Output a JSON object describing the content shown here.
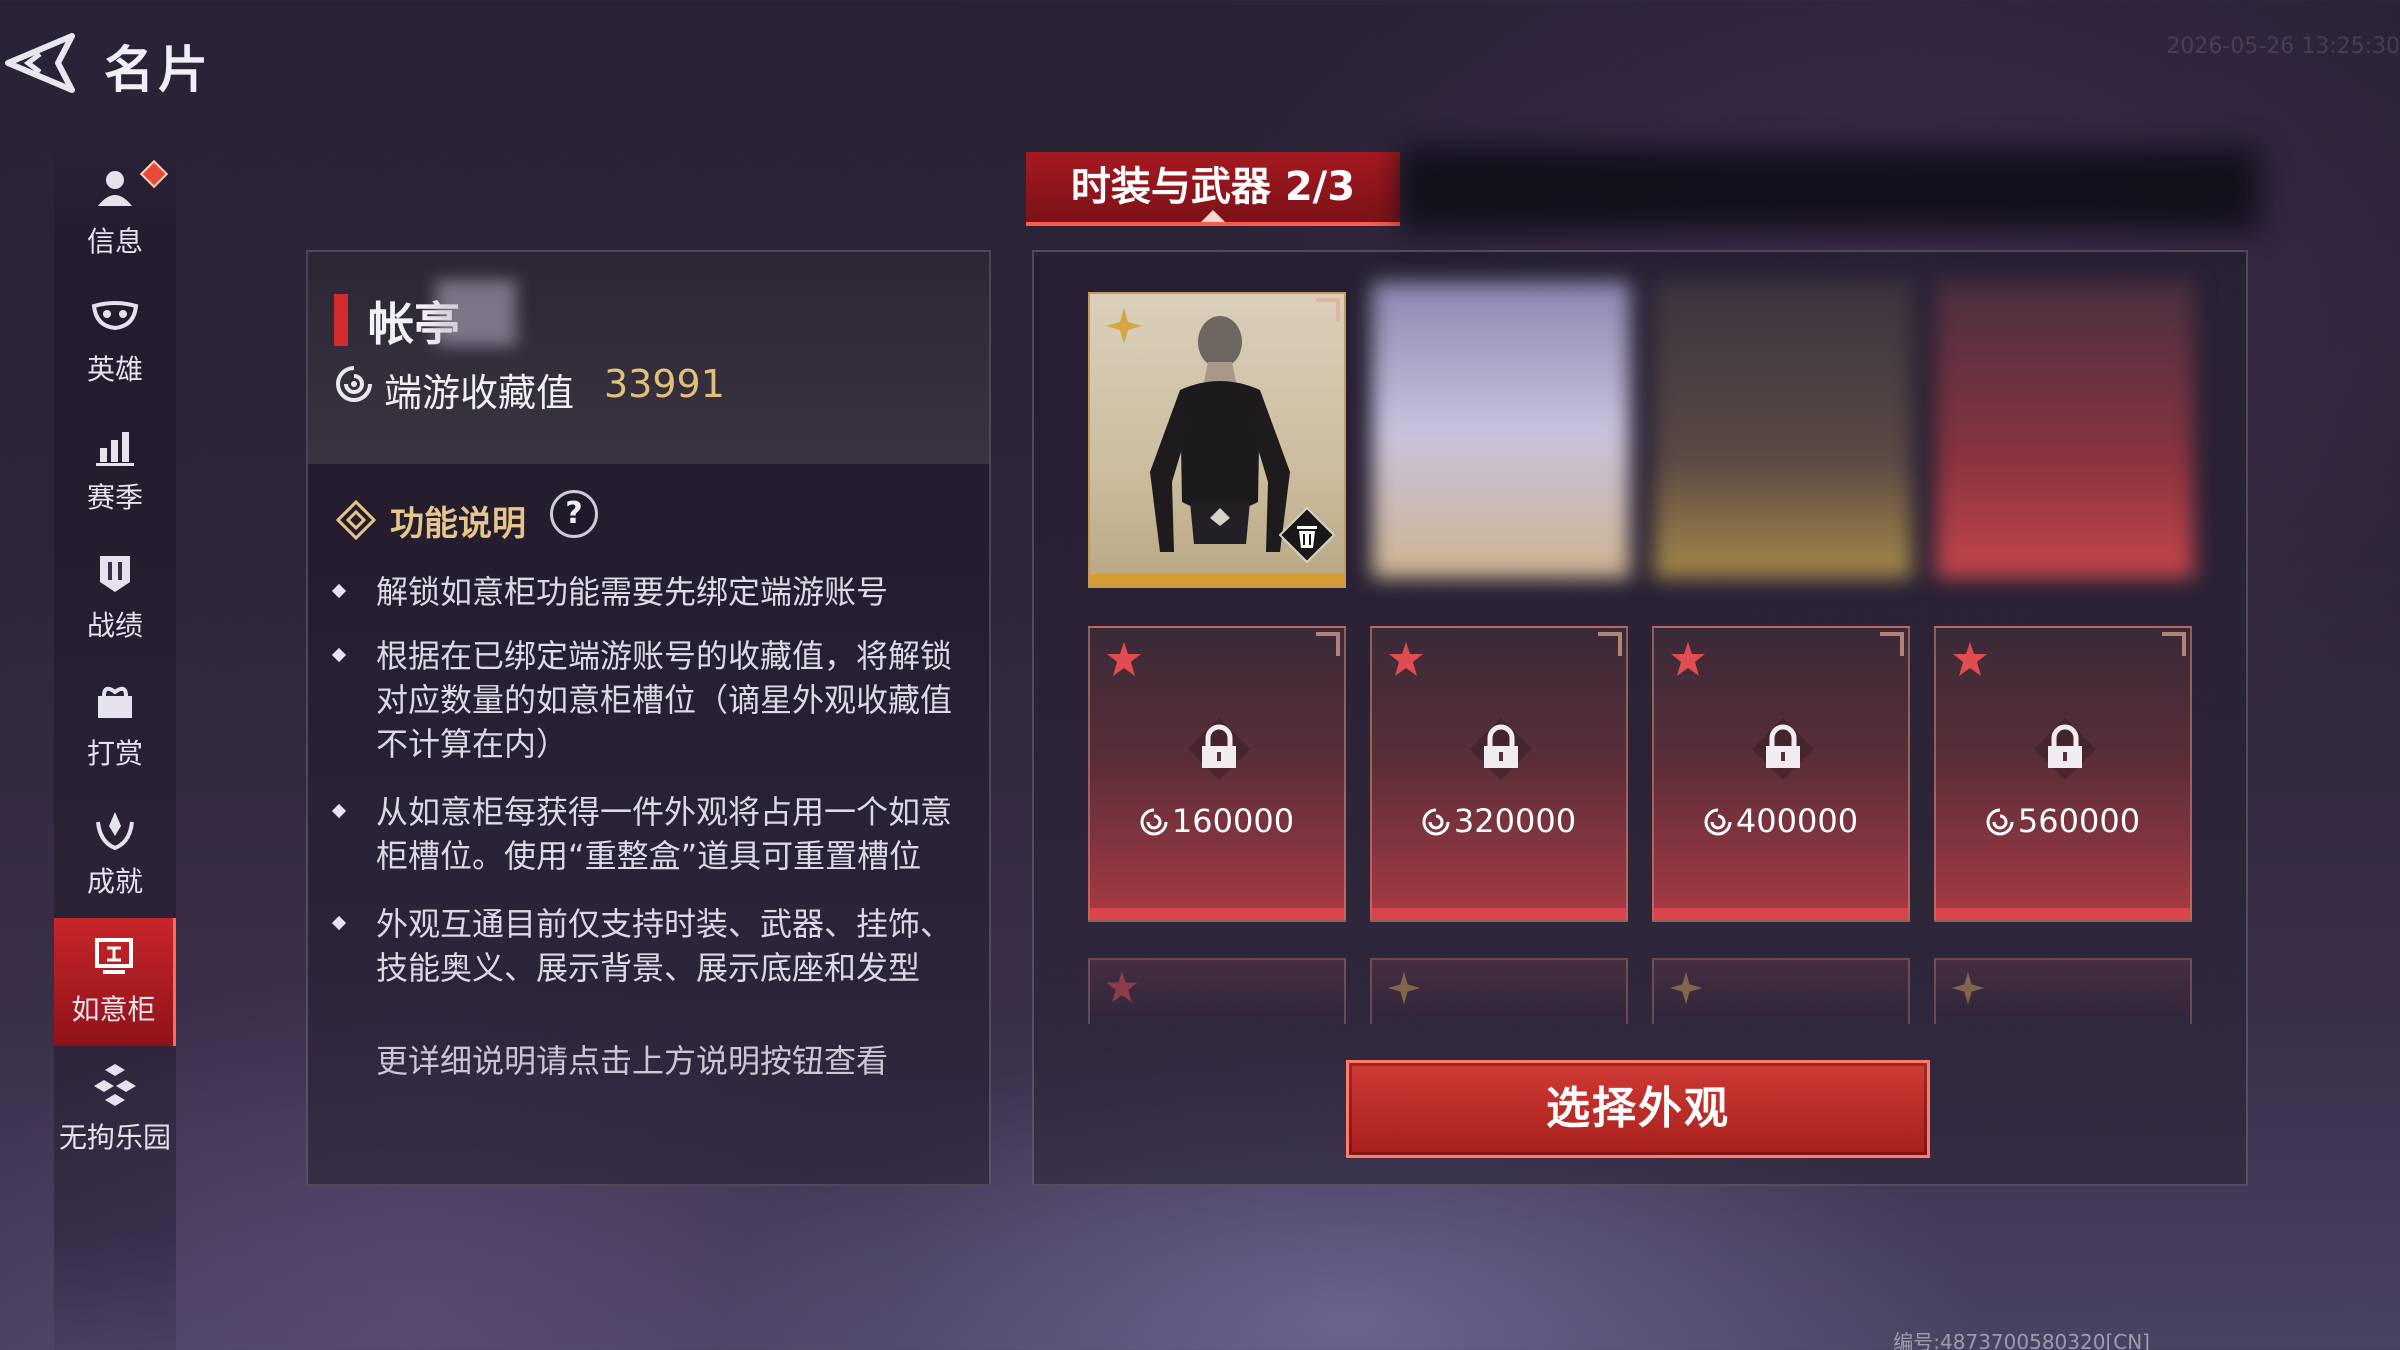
{
  "header": {
    "title": "名片",
    "timestamp": "2026-05-26 13:25:30"
  },
  "sidebar": {
    "items": [
      {
        "label": "信息",
        "icon": "user-icon",
        "badge": true
      },
      {
        "label": "英雄",
        "icon": "hero-mask-icon"
      },
      {
        "label": "赛季",
        "icon": "bar-chart-icon"
      },
      {
        "label": "战绩",
        "icon": "shield-icon"
      },
      {
        "label": "打赏",
        "icon": "gift-icon"
      },
      {
        "label": "成就",
        "icon": "laurel-icon"
      },
      {
        "label": "如意柜",
        "icon": "cabinet-icon",
        "active": true
      },
      {
        "label": "无拘乐园",
        "icon": "blocks-icon"
      }
    ]
  },
  "profile": {
    "name": "帐亭",
    "collection_label": "端游收藏值",
    "collection_value": "33991"
  },
  "help": {
    "title": "功能说明",
    "help_button": "?",
    "bullets": [
      "解锁如意柜功能需要先绑定端游账号",
      "根据在已绑定端游账号的收藏值，将解锁对应数量的如意柜槽位（谪星外观收藏值不计算在内）",
      "从如意柜每获得一件外观将占用一个如意柜槽位。使用“重整盒”道具可重置槽位",
      "外观互通目前仅支持时装、武器、挂饰、技能奥义、展示背景、展示底座和发型"
    ],
    "more": "更详细说明请点击上方说明按钮查看"
  },
  "tabs": {
    "active_label": "时装与武器 2/3"
  },
  "slots": {
    "locked": [
      {
        "cost": "160000"
      },
      {
        "cost": "320000"
      },
      {
        "cost": "400000"
      },
      {
        "cost": "560000"
      }
    ]
  },
  "select_button": "选择外观",
  "footer": {
    "uid": "编号:4873700580320[CN]"
  },
  "colors": {
    "accent_red": "#c8262a",
    "gold": "#e2c07a",
    "lock_red": "#d8454a"
  }
}
